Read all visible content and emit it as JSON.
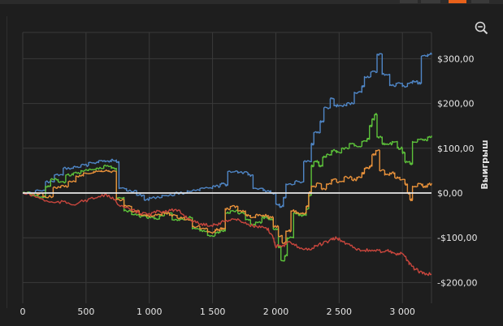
{
  "toolbar": {
    "zoom_icon": "zoom-out-icon"
  },
  "colors": {
    "background": "#1e1e1e",
    "grid": "#3a3a3a",
    "zero_line": "#e8e8e8",
    "accent_tab": "#e8611a"
  },
  "chart_data": {
    "type": "line",
    "title": "",
    "xlabel": "",
    "ylabel": "Выигрыш",
    "xlim": [
      0,
      3230
    ],
    "ylim": [
      -220,
      330
    ],
    "grid": true,
    "legend": "none",
    "x_ticks": [
      {
        "value": 0,
        "label": "0"
      },
      {
        "value": 500,
        "label": "500"
      },
      {
        "value": 1000,
        "label": "1 000"
      },
      {
        "value": 1500,
        "label": "1 500"
      },
      {
        "value": 2000,
        "label": "2 000"
      },
      {
        "value": 2500,
        "label": "2 500"
      },
      {
        "value": 3000,
        "label": "3 000"
      }
    ],
    "y_ticks": [
      {
        "value": 300,
        "label": "$300,00"
      },
      {
        "value": 200,
        "label": "$200,00"
      },
      {
        "value": 100,
        "label": "$100,00"
      },
      {
        "value": 0,
        "label": "$0,00"
      },
      {
        "value": -100,
        "label": "-$100,00"
      },
      {
        "value": -200,
        "label": "-$200,00"
      }
    ],
    "series": [
      {
        "color": "#4f86c6",
        "style": "step",
        "points": [
          [
            0,
            0
          ],
          [
            100,
            5
          ],
          [
            180,
            25
          ],
          [
            250,
            40
          ],
          [
            320,
            55
          ],
          [
            400,
            58
          ],
          [
            460,
            62
          ],
          [
            520,
            68
          ],
          [
            600,
            72
          ],
          [
            650,
            70
          ],
          [
            700,
            74
          ],
          [
            740,
            70
          ],
          [
            760,
            10
          ],
          [
            820,
            5
          ],
          [
            900,
            -5
          ],
          [
            960,
            -15
          ],
          [
            1000,
            -10
          ],
          [
            1100,
            -5
          ],
          [
            1200,
            0
          ],
          [
            1300,
            5
          ],
          [
            1400,
            10
          ],
          [
            1500,
            15
          ],
          [
            1560,
            20
          ],
          [
            1600,
            18
          ],
          [
            1620,
            48
          ],
          [
            1700,
            45
          ],
          [
            1780,
            40
          ],
          [
            1820,
            10
          ],
          [
            1900,
            5
          ],
          [
            1960,
            0
          ],
          [
            2000,
            -25
          ],
          [
            2030,
            -30
          ],
          [
            2060,
            -10
          ],
          [
            2080,
            20
          ],
          [
            2150,
            25
          ],
          [
            2220,
            70
          ],
          [
            2280,
            110
          ],
          [
            2300,
            135
          ],
          [
            2350,
            160
          ],
          [
            2380,
            190
          ],
          [
            2430,
            210
          ],
          [
            2460,
            195
          ],
          [
            2500,
            195
          ],
          [
            2560,
            200
          ],
          [
            2620,
            225
          ],
          [
            2680,
            238
          ],
          [
            2700,
            260
          ],
          [
            2750,
            270
          ],
          [
            2800,
            310
          ],
          [
            2840,
            265
          ],
          [
            2900,
            240
          ],
          [
            2950,
            245
          ],
          [
            3000,
            238
          ],
          [
            3040,
            245
          ],
          [
            3080,
            250
          ],
          [
            3120,
            245
          ],
          [
            3150,
            305
          ],
          [
            3200,
            310
          ],
          [
            3230,
            312
          ]
        ]
      },
      {
        "color": "#5cc13a",
        "style": "step",
        "points": [
          [
            0,
            0
          ],
          [
            60,
            -5
          ],
          [
            120,
            -10
          ],
          [
            180,
            15
          ],
          [
            220,
            30
          ],
          [
            280,
            25
          ],
          [
            340,
            40
          ],
          [
            400,
            45
          ],
          [
            460,
            50
          ],
          [
            520,
            52
          ],
          [
            580,
            55
          ],
          [
            640,
            60
          ],
          [
            700,
            55
          ],
          [
            740,
            -10
          ],
          [
            800,
            -40
          ],
          [
            860,
            -48
          ],
          [
            920,
            -52
          ],
          [
            980,
            -55
          ],
          [
            1040,
            -58
          ],
          [
            1080,
            -50
          ],
          [
            1120,
            -45
          ],
          [
            1150,
            -45
          ],
          [
            1180,
            -60
          ],
          [
            1230,
            -60
          ],
          [
            1280,
            -55
          ],
          [
            1340,
            -80
          ],
          [
            1400,
            -85
          ],
          [
            1460,
            -95
          ],
          [
            1520,
            -88
          ],
          [
            1560,
            -85
          ],
          [
            1600,
            -45
          ],
          [
            1640,
            -40
          ],
          [
            1700,
            -45
          ],
          [
            1760,
            -60
          ],
          [
            1800,
            -70
          ],
          [
            1840,
            -65
          ],
          [
            1890,
            -55
          ],
          [
            1940,
            -58
          ],
          [
            1960,
            -60
          ],
          [
            1980,
            -80
          ],
          [
            2020,
            -120
          ],
          [
            2040,
            -150
          ],
          [
            2070,
            -140
          ],
          [
            2090,
            -100
          ],
          [
            2140,
            -45
          ],
          [
            2180,
            -50
          ],
          [
            2220,
            -50
          ],
          [
            2240,
            -35
          ],
          [
            2260,
            -5
          ],
          [
            2280,
            60
          ],
          [
            2300,
            70
          ],
          [
            2340,
            60
          ],
          [
            2370,
            80
          ],
          [
            2400,
            85
          ],
          [
            2440,
            95
          ],
          [
            2480,
            90
          ],
          [
            2520,
            100
          ],
          [
            2580,
            110
          ],
          [
            2620,
            105
          ],
          [
            2680,
            115
          ],
          [
            2720,
            120
          ],
          [
            2740,
            150
          ],
          [
            2760,
            165
          ],
          [
            2780,
            175
          ],
          [
            2800,
            125
          ],
          [
            2840,
            110
          ],
          [
            2880,
            110
          ],
          [
            2920,
            115
          ],
          [
            2960,
            100
          ],
          [
            3000,
            90
          ],
          [
            3020,
            70
          ],
          [
            3060,
            65
          ],
          [
            3080,
            115
          ],
          [
            3120,
            120
          ],
          [
            3160,
            118
          ],
          [
            3200,
            125
          ],
          [
            3230,
            128
          ]
        ]
      },
      {
        "color": "#e8913a",
        "style": "step",
        "points": [
          [
            0,
            0
          ],
          [
            80,
            -2
          ],
          [
            160,
            -8
          ],
          [
            240,
            12
          ],
          [
            300,
            15
          ],
          [
            360,
            25
          ],
          [
            420,
            38
          ],
          [
            480,
            45
          ],
          [
            560,
            48
          ],
          [
            620,
            50
          ],
          [
            680,
            48
          ],
          [
            740,
            -15
          ],
          [
            800,
            -30
          ],
          [
            860,
            -40
          ],
          [
            920,
            -48
          ],
          [
            980,
            -52
          ],
          [
            1040,
            -50
          ],
          [
            1100,
            -45
          ],
          [
            1160,
            -50
          ],
          [
            1220,
            -55
          ],
          [
            1280,
            -60
          ],
          [
            1340,
            -75
          ],
          [
            1400,
            -80
          ],
          [
            1460,
            -88
          ],
          [
            1520,
            -82
          ],
          [
            1560,
            -80
          ],
          [
            1600,
            -35
          ],
          [
            1640,
            -30
          ],
          [
            1700,
            -40
          ],
          [
            1760,
            -50
          ],
          [
            1800,
            -55
          ],
          [
            1840,
            -50
          ],
          [
            1880,
            -50
          ],
          [
            1940,
            -55
          ],
          [
            1980,
            -75
          ],
          [
            2020,
            -95
          ],
          [
            2050,
            -110
          ],
          [
            2080,
            -85
          ],
          [
            2120,
            -40
          ],
          [
            2160,
            -45
          ],
          [
            2200,
            -45
          ],
          [
            2240,
            -30
          ],
          [
            2260,
            0
          ],
          [
            2280,
            15
          ],
          [
            2320,
            20
          ],
          [
            2360,
            10
          ],
          [
            2400,
            20
          ],
          [
            2440,
            30
          ],
          [
            2480,
            25
          ],
          [
            2540,
            35
          ],
          [
            2600,
            30
          ],
          [
            2640,
            35
          ],
          [
            2680,
            45
          ],
          [
            2700,
            55
          ],
          [
            2740,
            60
          ],
          [
            2760,
            85
          ],
          [
            2790,
            95
          ],
          [
            2820,
            50
          ],
          [
            2860,
            40
          ],
          [
            2900,
            45
          ],
          [
            2940,
            35
          ],
          [
            2980,
            30
          ],
          [
            3020,
            20
          ],
          [
            3040,
            0
          ],
          [
            3060,
            -15
          ],
          [
            3080,
            15
          ],
          [
            3120,
            20
          ],
          [
            3160,
            15
          ],
          [
            3200,
            20
          ],
          [
            3230,
            22
          ]
        ]
      },
      {
        "color": "#c9463d",
        "style": "walk",
        "points": [
          [
            0,
            0
          ],
          [
            80,
            -5
          ],
          [
            160,
            -15
          ],
          [
            240,
            -22
          ],
          [
            320,
            -20
          ],
          [
            400,
            -25
          ],
          [
            480,
            -18
          ],
          [
            560,
            -12
          ],
          [
            640,
            -5
          ],
          [
            700,
            -10
          ],
          [
            760,
            -25
          ],
          [
            820,
            -35
          ],
          [
            880,
            -40
          ],
          [
            940,
            -45
          ],
          [
            1000,
            -48
          ],
          [
            1060,
            -42
          ],
          [
            1120,
            -40
          ],
          [
            1180,
            -38
          ],
          [
            1240,
            -42
          ],
          [
            1300,
            -55
          ],
          [
            1360,
            -65
          ],
          [
            1420,
            -70
          ],
          [
            1480,
            -72
          ],
          [
            1540,
            -70
          ],
          [
            1600,
            -62
          ],
          [
            1660,
            -58
          ],
          [
            1720,
            -62
          ],
          [
            1780,
            -70
          ],
          [
            1840,
            -75
          ],
          [
            1900,
            -78
          ],
          [
            1940,
            -82
          ],
          [
            1980,
            -100
          ],
          [
            2000,
            -120
          ],
          [
            2020,
            -115
          ],
          [
            2060,
            -118
          ],
          [
            2100,
            -110
          ],
          [
            2160,
            -118
          ],
          [
            2220,
            -125
          ],
          [
            2280,
            -125
          ],
          [
            2320,
            -118
          ],
          [
            2380,
            -112
          ],
          [
            2440,
            -105
          ],
          [
            2480,
            -100
          ],
          [
            2520,
            -108
          ],
          [
            2580,
            -115
          ],
          [
            2640,
            -125
          ],
          [
            2700,
            -128
          ],
          [
            2760,
            -128
          ],
          [
            2820,
            -130
          ],
          [
            2880,
            -128
          ],
          [
            2920,
            -132
          ],
          [
            2960,
            -138
          ],
          [
            3000,
            -135
          ],
          [
            3040,
            -150
          ],
          [
            3060,
            -160
          ],
          [
            3100,
            -170
          ],
          [
            3140,
            -176
          ],
          [
            3180,
            -180
          ],
          [
            3230,
            -182
          ]
        ]
      }
    ]
  }
}
